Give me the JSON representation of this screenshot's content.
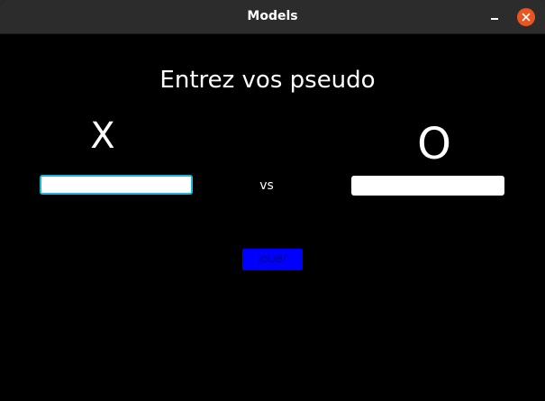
{
  "window": {
    "title": "Models",
    "minimize_icon": "minimize-icon",
    "close_icon": "close-icon",
    "close_color": "#e95420"
  },
  "form": {
    "heading": "Entrez vos pseudo",
    "player_x_label": "X",
    "player_o_label": "O",
    "vs_label": "vs",
    "player_x_value": "",
    "player_o_value": "",
    "play_button_label": "jouer",
    "play_button_color": "#0000ff",
    "focus_color": "#19b6d8"
  }
}
